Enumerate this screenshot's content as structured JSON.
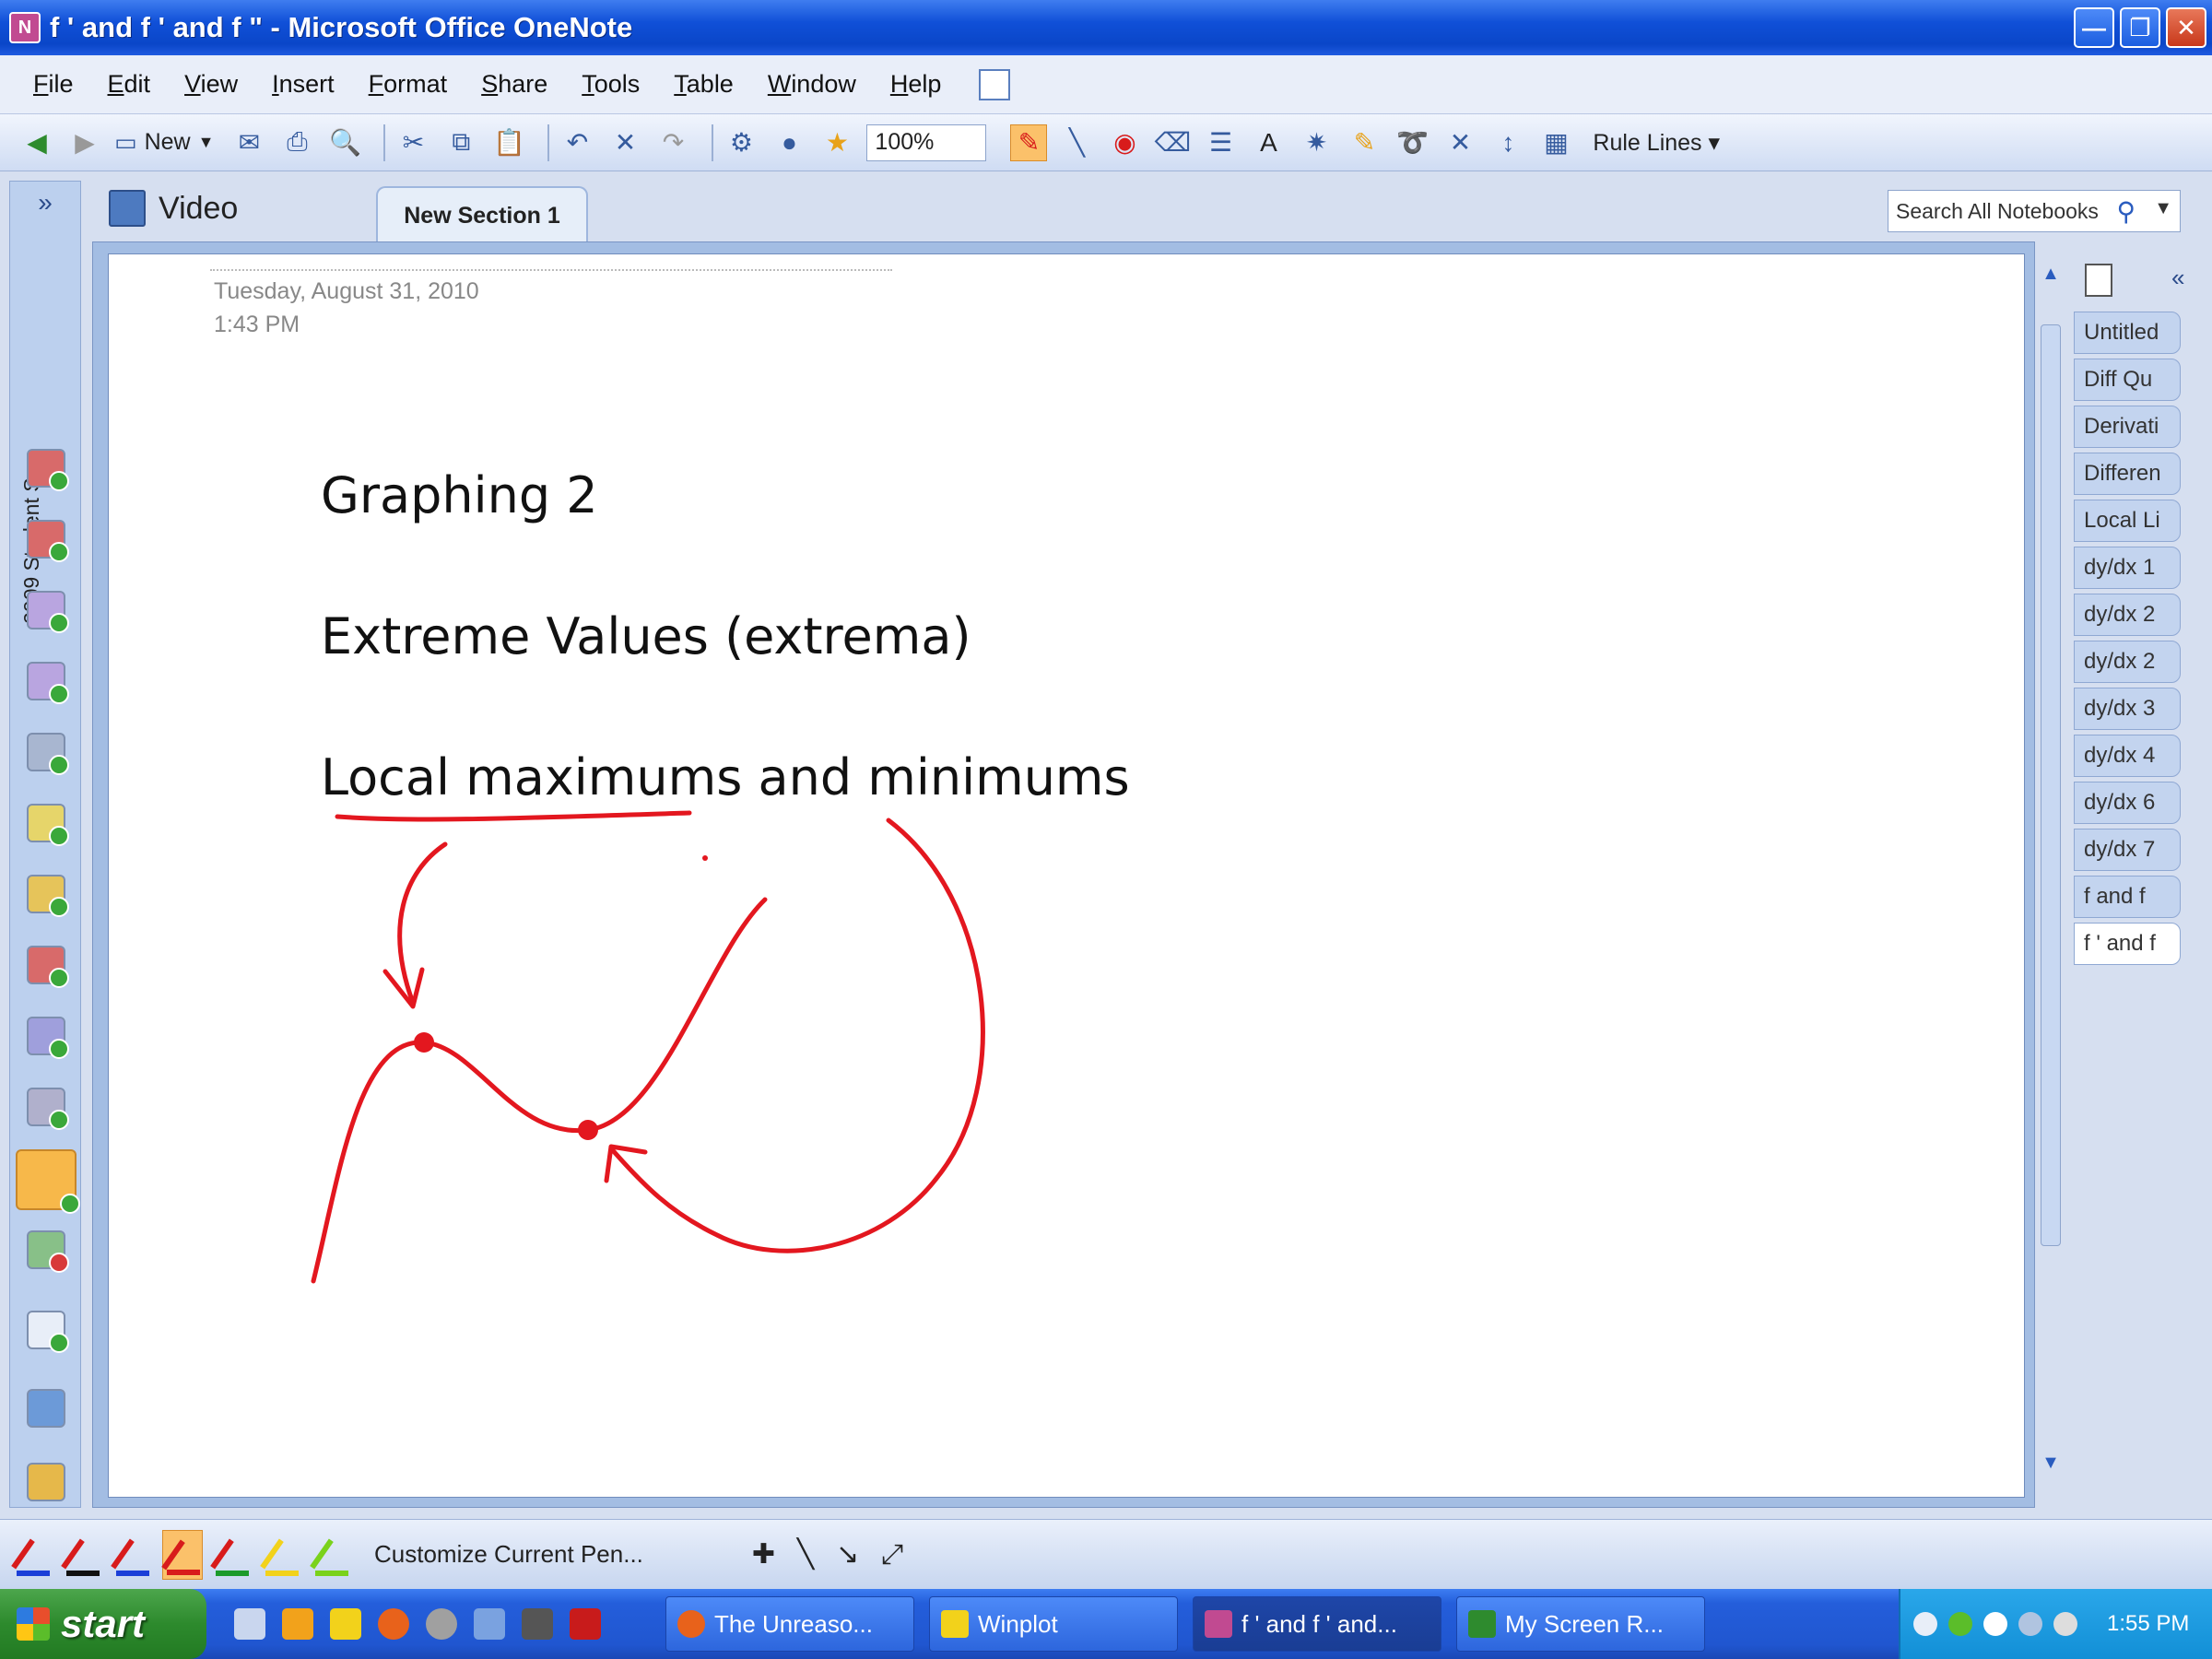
{
  "window": {
    "title": "f ' and f ' and f \" - Microsoft Office OneNote",
    "buttons": [
      "minimize",
      "restore",
      "close"
    ]
  },
  "menubar": {
    "items": [
      "File",
      "Edit",
      "View",
      "Insert",
      "Format",
      "Share",
      "Tools",
      "Table",
      "Window",
      "Help"
    ]
  },
  "toolbar": {
    "new_label": "New",
    "zoom": "100%",
    "rule_lines_label": "Rule Lines",
    "pen_color": "#d81b1b"
  },
  "notebook_bar": {
    "label": "2009 Student Sa..."
  },
  "section": {
    "notebook_name": "Video",
    "active_tab": "New Section 1"
  },
  "search": {
    "placeholder": "Search All Notebooks"
  },
  "page": {
    "date": "Tuesday, August 31, 2010",
    "time": "1:43 PM",
    "lines": [
      "Graphing 2",
      "Extreme Values (extrema)",
      "Local maximums and minimums"
    ],
    "ink_color": "#e3171f"
  },
  "page_tabs": [
    "Untitled",
    "Diff Qu",
    "Derivati",
    "Differen",
    "Local Li",
    "dy/dx 1",
    "dy/dx 2",
    "dy/dx 2",
    "dy/dx 3",
    "dy/dx 4",
    "dy/dx 6",
    "dy/dx 7",
    "f  and f",
    "f ' and f"
  ],
  "pen_toolbar": {
    "customize_label": "Customize Current Pen..."
  },
  "taskbar": {
    "start_label": "start",
    "tasks": [
      "The Unreaso...",
      "Winplot",
      "f ' and f ' and...",
      "My Screen R..."
    ],
    "clock": "1:55 PM"
  }
}
